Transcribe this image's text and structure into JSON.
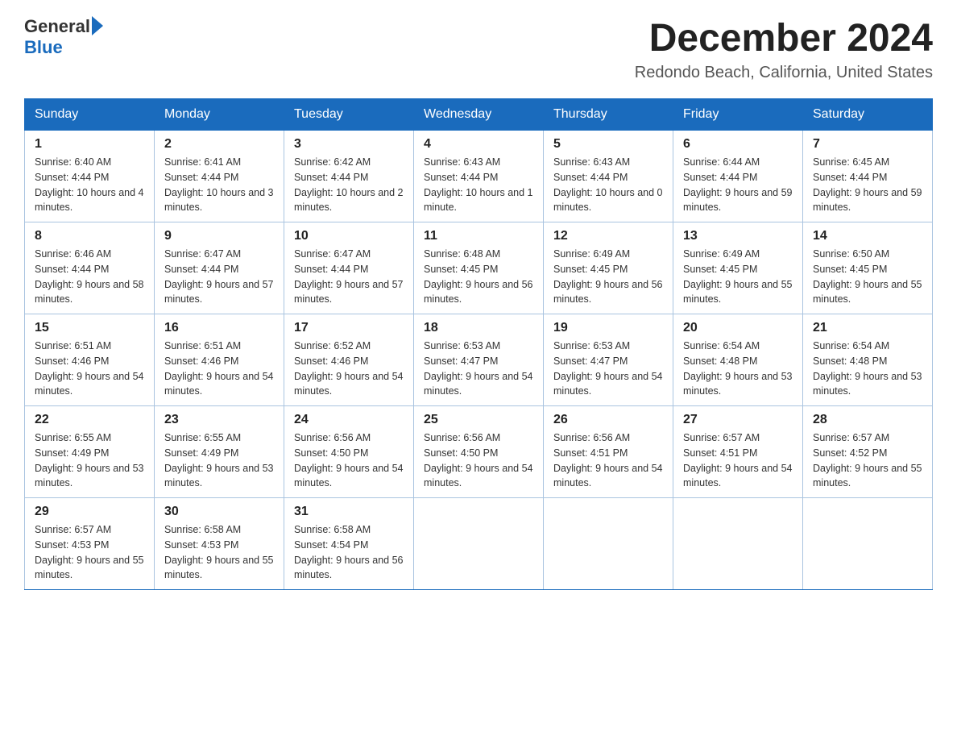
{
  "header": {
    "logo_general": "General",
    "logo_blue": "Blue",
    "month_title": "December 2024",
    "location": "Redondo Beach, California, United States"
  },
  "weekdays": [
    "Sunday",
    "Monday",
    "Tuesday",
    "Wednesday",
    "Thursday",
    "Friday",
    "Saturday"
  ],
  "weeks": [
    [
      {
        "day": "1",
        "sunrise": "6:40 AM",
        "sunset": "4:44 PM",
        "daylight": "10 hours and 4 minutes."
      },
      {
        "day": "2",
        "sunrise": "6:41 AM",
        "sunset": "4:44 PM",
        "daylight": "10 hours and 3 minutes."
      },
      {
        "day": "3",
        "sunrise": "6:42 AM",
        "sunset": "4:44 PM",
        "daylight": "10 hours and 2 minutes."
      },
      {
        "day": "4",
        "sunrise": "6:43 AM",
        "sunset": "4:44 PM",
        "daylight": "10 hours and 1 minute."
      },
      {
        "day": "5",
        "sunrise": "6:43 AM",
        "sunset": "4:44 PM",
        "daylight": "10 hours and 0 minutes."
      },
      {
        "day": "6",
        "sunrise": "6:44 AM",
        "sunset": "4:44 PM",
        "daylight": "9 hours and 59 minutes."
      },
      {
        "day": "7",
        "sunrise": "6:45 AM",
        "sunset": "4:44 PM",
        "daylight": "9 hours and 59 minutes."
      }
    ],
    [
      {
        "day": "8",
        "sunrise": "6:46 AM",
        "sunset": "4:44 PM",
        "daylight": "9 hours and 58 minutes."
      },
      {
        "day": "9",
        "sunrise": "6:47 AM",
        "sunset": "4:44 PM",
        "daylight": "9 hours and 57 minutes."
      },
      {
        "day": "10",
        "sunrise": "6:47 AM",
        "sunset": "4:44 PM",
        "daylight": "9 hours and 57 minutes."
      },
      {
        "day": "11",
        "sunrise": "6:48 AM",
        "sunset": "4:45 PM",
        "daylight": "9 hours and 56 minutes."
      },
      {
        "day": "12",
        "sunrise": "6:49 AM",
        "sunset": "4:45 PM",
        "daylight": "9 hours and 56 minutes."
      },
      {
        "day": "13",
        "sunrise": "6:49 AM",
        "sunset": "4:45 PM",
        "daylight": "9 hours and 55 minutes."
      },
      {
        "day": "14",
        "sunrise": "6:50 AM",
        "sunset": "4:45 PM",
        "daylight": "9 hours and 55 minutes."
      }
    ],
    [
      {
        "day": "15",
        "sunrise": "6:51 AM",
        "sunset": "4:46 PM",
        "daylight": "9 hours and 54 minutes."
      },
      {
        "day": "16",
        "sunrise": "6:51 AM",
        "sunset": "4:46 PM",
        "daylight": "9 hours and 54 minutes."
      },
      {
        "day": "17",
        "sunrise": "6:52 AM",
        "sunset": "4:46 PM",
        "daylight": "9 hours and 54 minutes."
      },
      {
        "day": "18",
        "sunrise": "6:53 AM",
        "sunset": "4:47 PM",
        "daylight": "9 hours and 54 minutes."
      },
      {
        "day": "19",
        "sunrise": "6:53 AM",
        "sunset": "4:47 PM",
        "daylight": "9 hours and 54 minutes."
      },
      {
        "day": "20",
        "sunrise": "6:54 AM",
        "sunset": "4:48 PM",
        "daylight": "9 hours and 53 minutes."
      },
      {
        "day": "21",
        "sunrise": "6:54 AM",
        "sunset": "4:48 PM",
        "daylight": "9 hours and 53 minutes."
      }
    ],
    [
      {
        "day": "22",
        "sunrise": "6:55 AM",
        "sunset": "4:49 PM",
        "daylight": "9 hours and 53 minutes."
      },
      {
        "day": "23",
        "sunrise": "6:55 AM",
        "sunset": "4:49 PM",
        "daylight": "9 hours and 53 minutes."
      },
      {
        "day": "24",
        "sunrise": "6:56 AM",
        "sunset": "4:50 PM",
        "daylight": "9 hours and 54 minutes."
      },
      {
        "day": "25",
        "sunrise": "6:56 AM",
        "sunset": "4:50 PM",
        "daylight": "9 hours and 54 minutes."
      },
      {
        "day": "26",
        "sunrise": "6:56 AM",
        "sunset": "4:51 PM",
        "daylight": "9 hours and 54 minutes."
      },
      {
        "day": "27",
        "sunrise": "6:57 AM",
        "sunset": "4:51 PM",
        "daylight": "9 hours and 54 minutes."
      },
      {
        "day": "28",
        "sunrise": "6:57 AM",
        "sunset": "4:52 PM",
        "daylight": "9 hours and 55 minutes."
      }
    ],
    [
      {
        "day": "29",
        "sunrise": "6:57 AM",
        "sunset": "4:53 PM",
        "daylight": "9 hours and 55 minutes."
      },
      {
        "day": "30",
        "sunrise": "6:58 AM",
        "sunset": "4:53 PM",
        "daylight": "9 hours and 55 minutes."
      },
      {
        "day": "31",
        "sunrise": "6:58 AM",
        "sunset": "4:54 PM",
        "daylight": "9 hours and 56 minutes."
      },
      null,
      null,
      null,
      null
    ]
  ],
  "labels": {
    "sunrise": "Sunrise:",
    "sunset": "Sunset:",
    "daylight": "Daylight:"
  }
}
